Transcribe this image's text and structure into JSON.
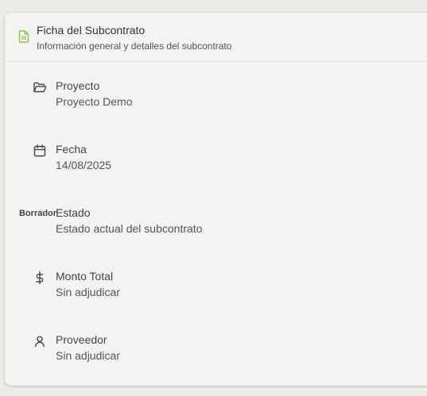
{
  "card": {
    "title": "Ficha del Subcontrato",
    "subtitle": "Información general y detalles del subcontrato",
    "accent_color": "#8bc34a"
  },
  "fields": [
    {
      "icon": "folder-open-icon",
      "label": "Proyecto",
      "value": "Proyecto Demo"
    },
    {
      "icon": "calendar-icon",
      "label": "Fecha",
      "value": "14/08/2025"
    },
    {
      "badge": "Borrador",
      "label": "Estado",
      "value": "Estado actual del subcontrato"
    },
    {
      "icon": "dollar-icon",
      "label": "Monto Total",
      "value": "Sin adjudicar"
    },
    {
      "icon": "user-icon",
      "label": "Proveedor",
      "value": "Sin adjudicar"
    }
  ]
}
